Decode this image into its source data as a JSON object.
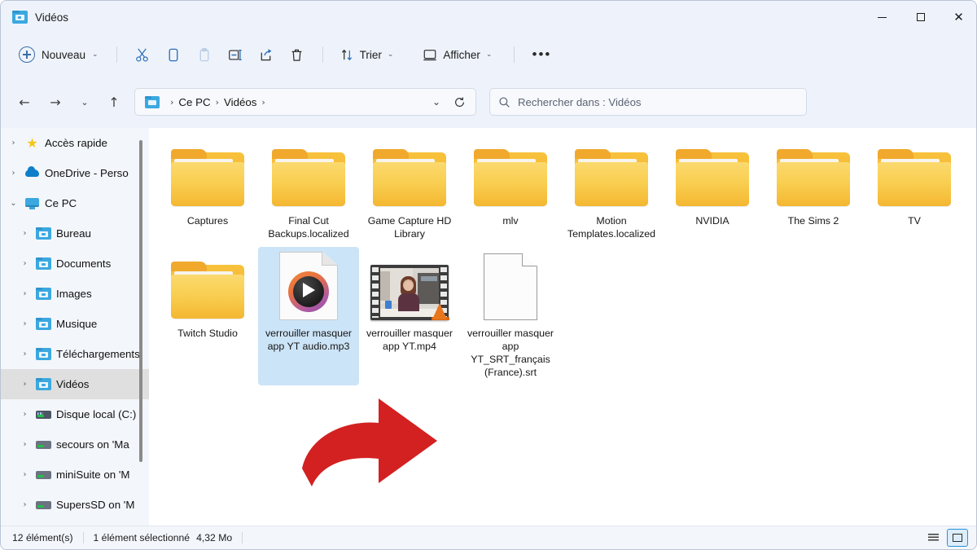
{
  "window": {
    "title": "Vidéos",
    "title_icon": "folder-videos-icon",
    "minimize_label": "—",
    "maximize_label": "□",
    "close_label": "✕"
  },
  "toolbar": {
    "new_label": "Nouveau",
    "new_chevron": "⌄",
    "cut_label": "Couper",
    "copy_label": "Copier",
    "paste_label": "Coller",
    "rename_label": "Renommer",
    "share_label": "Partager",
    "delete_label": "Supprimer",
    "sort_label": "Trier",
    "sort_chevron": "⌄",
    "view_label": "Afficher",
    "view_chevron": "⌄",
    "more_label": "•••"
  },
  "addressbar": {
    "back": "←",
    "forward": "→",
    "recent_chevron": "⌄",
    "up": "↑",
    "breadcrumb_icon": "this-pc-folder-icon",
    "breadcrumbs": [
      "Ce PC",
      "Vidéos"
    ],
    "separator": "›",
    "dropdown_chevron": "⌄",
    "refresh": "↻"
  },
  "search": {
    "placeholder": "Rechercher dans : Vidéos",
    "icon": "search-icon"
  },
  "sidebar": {
    "items": [
      {
        "label": "Accès rapide",
        "icon": "star-icon",
        "indent": false,
        "chevron": "›",
        "selected": false
      },
      {
        "label": "OneDrive - Perso",
        "icon": "cloud-icon",
        "indent": false,
        "chevron": "›",
        "selected": false
      },
      {
        "label": "Ce PC",
        "icon": "pc-icon",
        "indent": false,
        "chevron": "⌄",
        "selected": false
      },
      {
        "label": "Bureau",
        "icon": "folder-icon",
        "indent": true,
        "chevron": "›",
        "selected": false
      },
      {
        "label": "Documents",
        "icon": "folder-icon",
        "indent": true,
        "chevron": "›",
        "selected": false
      },
      {
        "label": "Images",
        "icon": "folder-icon",
        "indent": true,
        "chevron": "›",
        "selected": false
      },
      {
        "label": "Musique",
        "icon": "folder-icon",
        "indent": true,
        "chevron": "›",
        "selected": false
      },
      {
        "label": "Téléchargements",
        "icon": "folder-icon",
        "indent": true,
        "chevron": "›",
        "selected": false
      },
      {
        "label": "Vidéos",
        "icon": "folder-icon",
        "indent": true,
        "chevron": "›",
        "selected": true
      },
      {
        "label": "Disque local (C:)",
        "icon": "hdd-icon",
        "indent": true,
        "chevron": "›",
        "selected": false
      },
      {
        "label": "secours on 'Ma",
        "icon": "network-drive-icon",
        "indent": true,
        "chevron": "›",
        "selected": false
      },
      {
        "label": "miniSuite on 'M",
        "icon": "network-drive-icon",
        "indent": true,
        "chevron": "›",
        "selected": false
      },
      {
        "label": "SupersSD on 'M",
        "icon": "network-drive-icon",
        "indent": true,
        "chevron": "›",
        "selected": false
      }
    ]
  },
  "files": {
    "items": [
      {
        "name": "Captures",
        "type": "folder",
        "selected": false
      },
      {
        "name": "Final Cut Backups.localized",
        "type": "folder",
        "selected": false
      },
      {
        "name": "Game Capture HD Library",
        "type": "folder",
        "selected": false
      },
      {
        "name": "mlv",
        "type": "folder",
        "selected": false
      },
      {
        "name": "Motion Templates.localized",
        "type": "folder",
        "selected": false
      },
      {
        "name": "NVIDIA",
        "type": "folder",
        "selected": false
      },
      {
        "name": "The Sims 2",
        "type": "folder",
        "selected": false
      },
      {
        "name": "TV",
        "type": "folder",
        "selected": false
      },
      {
        "name": "Twitch Studio",
        "type": "folder",
        "selected": false
      },
      {
        "name": "verrouiller masquer app YT audio.mp3",
        "type": "mp3",
        "selected": true
      },
      {
        "name": "verrouiller masquer app YT.mp4",
        "type": "mp4",
        "selected": false
      },
      {
        "name": "verrouiller masquer app YT_SRT_français (France).srt",
        "type": "srt",
        "selected": false
      }
    ]
  },
  "statusbar": {
    "count": "12 élément(s)",
    "selection": "1 élément sélectionné",
    "size": "4,32 Mo",
    "list_view_label": "Affichage liste",
    "icon_view_label": "Grandes icônes"
  },
  "annotation": {
    "type": "curved-arrow",
    "color": "#d32121",
    "points_to": "verrouiller masquer app YT audio.mp3"
  },
  "colors": {
    "chrome": "#eef3fb",
    "selection": "#cce4f7",
    "sidebar": "#f3f6fb",
    "accent": "#2a8fd8",
    "folder_yellow": "#f9cf52",
    "annotation_red": "#d32121"
  }
}
